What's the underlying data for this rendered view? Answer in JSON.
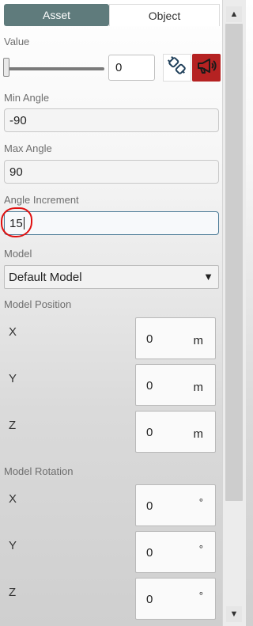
{
  "tabs": [
    {
      "label": "Asset",
      "active": false
    },
    {
      "label": "Object",
      "active": true
    }
  ],
  "value": {
    "label": "Value",
    "slider_fraction": 0,
    "field_value": "0",
    "plug_icon": "plug-icon",
    "megaphone_icon": "megaphone-icon"
  },
  "min_angle": {
    "label": "Min Angle",
    "value": "-90"
  },
  "max_angle": {
    "label": "Max Angle",
    "value": "90"
  },
  "angle_increment": {
    "label": "Angle Increment",
    "value": "15"
  },
  "model": {
    "label": "Model",
    "selected": "Default Model",
    "arrow": "▼"
  },
  "model_position": {
    "label": "Model Position",
    "rows": [
      {
        "axis": "X",
        "value": "0",
        "unit": "m"
      },
      {
        "axis": "Y",
        "value": "0",
        "unit": "m"
      },
      {
        "axis": "Z",
        "value": "0",
        "unit": "m"
      }
    ]
  },
  "model_rotation": {
    "label": "Model Rotation",
    "rows": [
      {
        "axis": "X",
        "value": "0",
        "unit": "°"
      },
      {
        "axis": "Y",
        "value": "0",
        "unit": "°"
      },
      {
        "axis": "Z",
        "value": "0",
        "unit": "°"
      }
    ]
  },
  "scrollbar": {
    "up": "▲",
    "down": "▼"
  },
  "colors": {
    "tab_active_bg": "#5f7b7c",
    "megaphone_bg": "#b52222",
    "focus_border": "#4a7a96",
    "annotation": "#e01010"
  }
}
